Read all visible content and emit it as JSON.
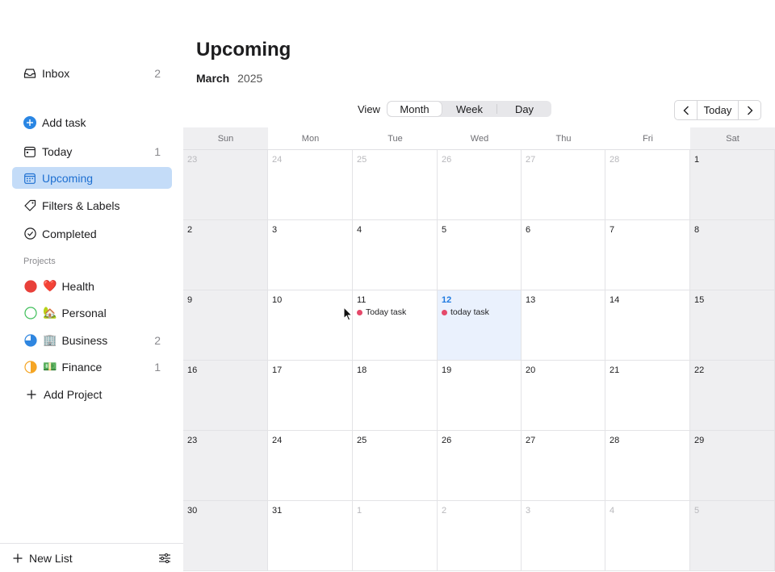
{
  "sidebar": {
    "inbox": {
      "label": "Inbox",
      "count": "2"
    },
    "add_task": {
      "label": "Add task"
    },
    "today": {
      "label": "Today",
      "count": "1"
    },
    "upcoming": {
      "label": "Upcoming"
    },
    "filters": {
      "label": "Filters & Labels"
    },
    "completed": {
      "label": "Completed"
    },
    "projects_heading": "Projects",
    "projects": [
      {
        "emoji": "❤️",
        "label": "Health",
        "count": "",
        "color": "#e8403a",
        "icon": "filled-circle-icon"
      },
      {
        "emoji": "🏡",
        "label": "Personal",
        "count": "",
        "color": "#3fbf5a",
        "icon": "empty-circle-icon"
      },
      {
        "emoji": "🏢",
        "label": "Business",
        "count": "2",
        "color": "#2f86e0",
        "icon": "pie-quarter-icon"
      },
      {
        "emoji": "💵",
        "label": "Finance",
        "count": "1",
        "color": "#f5a524",
        "icon": "half-circle-icon"
      }
    ],
    "add_project": {
      "label": "Add Project"
    },
    "new_list": {
      "label": "New List"
    }
  },
  "main": {
    "title": "Upcoming",
    "month": "March",
    "year": "2025",
    "view_label": "View",
    "view_options": [
      "Month",
      "Week",
      "Day"
    ],
    "selected_view": "Month",
    "nav": {
      "today_label": "Today"
    }
  },
  "calendar": {
    "weekdays": [
      "Sun",
      "Mon",
      "Tue",
      "Wed",
      "Thu",
      "Fri",
      "Sat"
    ],
    "weeks": [
      [
        {
          "d": "23",
          "dim": true
        },
        {
          "d": "24",
          "dim": true
        },
        {
          "d": "25",
          "dim": true
        },
        {
          "d": "26",
          "dim": true
        },
        {
          "d": "27",
          "dim": true
        },
        {
          "d": "28",
          "dim": true
        },
        {
          "d": "1"
        }
      ],
      [
        {
          "d": "2"
        },
        {
          "d": "3"
        },
        {
          "d": "4"
        },
        {
          "d": "5"
        },
        {
          "d": "6"
        },
        {
          "d": "7"
        },
        {
          "d": "8"
        }
      ],
      [
        {
          "d": "9"
        },
        {
          "d": "10"
        },
        {
          "d": "11",
          "task": "Today task"
        },
        {
          "d": "12",
          "today": true,
          "task": "today task"
        },
        {
          "d": "13"
        },
        {
          "d": "14"
        },
        {
          "d": "15"
        }
      ],
      [
        {
          "d": "16"
        },
        {
          "d": "17"
        },
        {
          "d": "18"
        },
        {
          "d": "19"
        },
        {
          "d": "20"
        },
        {
          "d": "21"
        },
        {
          "d": "22"
        }
      ],
      [
        {
          "d": "23"
        },
        {
          "d": "24"
        },
        {
          "d": "25"
        },
        {
          "d": "26"
        },
        {
          "d": "27"
        },
        {
          "d": "28"
        },
        {
          "d": "29"
        }
      ],
      [
        {
          "d": "30"
        },
        {
          "d": "31"
        },
        {
          "d": "1",
          "dim": true
        },
        {
          "d": "2",
          "dim": true
        },
        {
          "d": "3",
          "dim": true
        },
        {
          "d": "4",
          "dim": true
        },
        {
          "d": "5",
          "dim": true
        }
      ]
    ],
    "task_color": "#e5496a",
    "today_color": "#1f7ae0"
  }
}
